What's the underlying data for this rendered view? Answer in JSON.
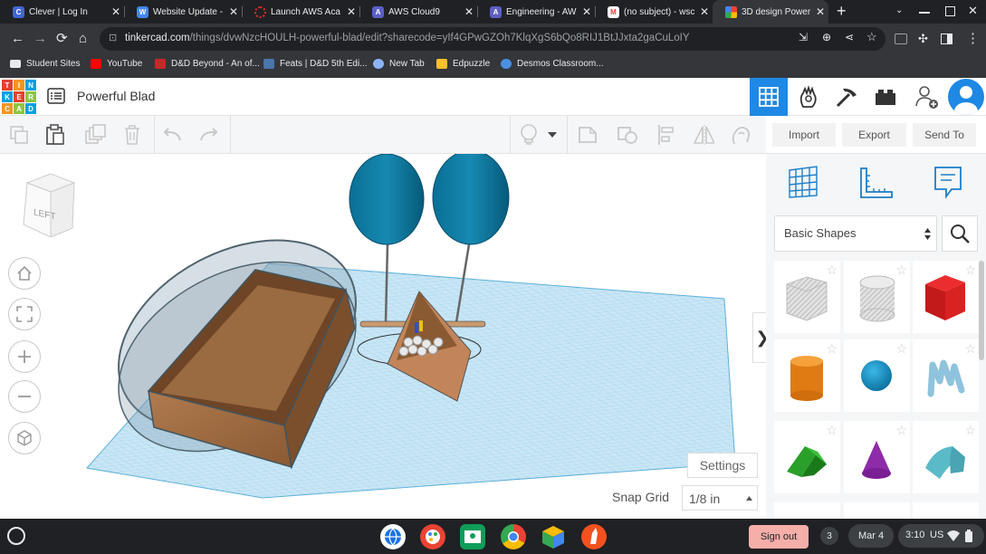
{
  "browser": {
    "tabs": [
      {
        "title": "Clever | Log In",
        "favicon_color": "#4066d4",
        "favicon_letter": "C"
      },
      {
        "title": "Website Update -",
        "favicon_color": "#4285f4",
        "favicon_letter": "W"
      },
      {
        "title": "Launch AWS Aca",
        "favicon_color": "#d93025",
        "favicon_letter": ""
      },
      {
        "title": "AWS Cloud9",
        "favicon_color": "#5b5fc7",
        "favicon_letter": "A"
      },
      {
        "title": "Engineering - AW",
        "favicon_color": "#5b5fc7",
        "favicon_letter": "A"
      },
      {
        "title": "(no subject) - wsc",
        "favicon_color": "#ea4335",
        "favicon_letter": "M"
      },
      {
        "title": "3D design Power",
        "favicon_color": "#ff9800",
        "favicon_letter": ""
      }
    ],
    "new_tab": "+",
    "url_domain": "tinkercad.com",
    "url_path": "/things/dvwNzcHOULH-powerful-blad/edit?sharecode=yIf4GPwGZOh7KlqXgS6bQo8RIJ1BtJJxta2gaCuLoIY",
    "bookmarks": [
      {
        "label": "Student Sites",
        "color": "#e8eaed"
      },
      {
        "label": "YouTube",
        "color": "#ff0000"
      },
      {
        "label": "D&D Beyond - An of...",
        "color": "#c62828"
      },
      {
        "label": "Feats | D&D 5th Edi...",
        "color": "#4a76a8"
      },
      {
        "label": "New Tab",
        "color": "#8ab4f8"
      },
      {
        "label": "Edpuzzle",
        "color": "#fbc02d"
      },
      {
        "label": "Desmos Classroom...",
        "color": "#4a90e2"
      }
    ]
  },
  "app": {
    "logo_letters": [
      "TIN",
      "KER",
      "CAD"
    ],
    "project_name": "Powerful Blad",
    "right_buttons": {
      "import": "Import",
      "export": "Export",
      "send_to": "Send To"
    }
  },
  "viewcube": {
    "face_label": "LEFT"
  },
  "workplane": {
    "settings_label": "Settings",
    "snap_grid_label": "Snap Grid",
    "snap_grid_value": "1/8 in"
  },
  "panel": {
    "shape_category": "Basic Shapes",
    "collapse_arrow": "❯",
    "shapes": [
      "Box Hole",
      "Cylinder Hole",
      "Box",
      "Cylinder",
      "Sphere",
      "Scribble",
      "Roof",
      "Cone",
      "Round Roof"
    ]
  },
  "taskbar": {
    "sign_out": "Sign out",
    "notif_count": "3",
    "date": "Mar 4",
    "time": "3:10",
    "locale": "US"
  }
}
